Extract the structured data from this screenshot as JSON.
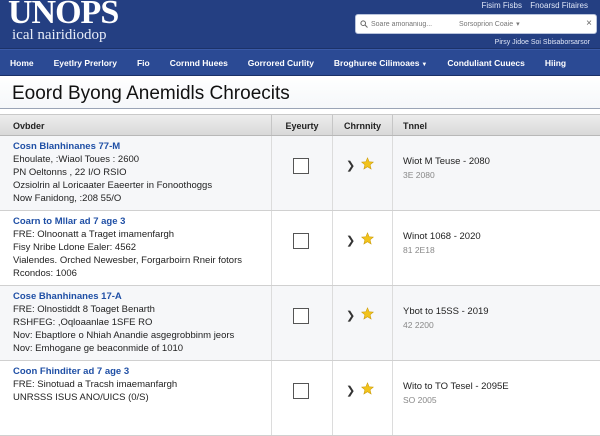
{
  "header": {
    "logo": "UNOPS",
    "logo_sub": "ical nairidiodop",
    "top_links": [
      "Fisim Fisbs",
      "Fnoarsd Fitaires"
    ],
    "search": {
      "placeholder": "Soare amonaniug...",
      "select_value": "Sorsoprion Coaie"
    },
    "sub_links": "Pirsy Jidoe Soi Sbisaborsarsor"
  },
  "nav": {
    "items": [
      "Home",
      "Eyetlry Prerlory",
      "Fio",
      "Cornnd Huees",
      "Gorrored Curlity",
      "Broghuree Cilimoaes",
      "Conduliant Cuuecs",
      "Hiing"
    ]
  },
  "page": {
    "title": "Eoord Byong Anemidls Chroecits"
  },
  "table": {
    "headers": [
      "Ovbder",
      "Eyeurty",
      "Chrnnity",
      "Tnnel"
    ],
    "rows": [
      {
        "title": "Cosn Blanhinanes 77-M",
        "lines": [
          "Ehoulate, :Wiaol Toues : 2600",
          "PN Oeltonns , 22 I/O RSIO",
          "Ozsiolrin al Loricaater Eaeerter in Fonoothoggs",
          "Now Fanidong, :208 55/O"
        ],
        "date": "Wiot M Teuse - 2080",
        "date_sub": "3E 2080"
      },
      {
        "title": "Coarn to Mllar ad 7 age 3",
        "lines": [
          "FRE: Olnoonatt a Traget imamenfargh",
          "Fisy Nribe Ldone Ealer: 4562",
          "Vialendes. Orched Newesber, Forgarboirn Rneir fotors",
          "Rcondos: 1006"
        ],
        "date": "Winot 1068 - 2020",
        "date_sub": "81 2E18"
      },
      {
        "title": "Cose Bhanhinanes 17-A",
        "lines": [
          "FRE: Olnostiddt 8 Toaget Benarth",
          "RSHFEG: ,Oqloaanlae 1SFE RO",
          "Nov: Ebaptlore o Nhiah Anandie asgegrobbinm jeors",
          "Nov: Emhogane ge beaconmide of 1010"
        ],
        "date": "Ybot to 15SS - 2019",
        "date_sub": "42 2200"
      },
      {
        "title": "Coon Fhinditer ad 7 age 3",
        "lines": [
          "FRE: Sinotuad a Tracsh imaemanfargh",
          "UNRSSS ISUS ANO/UICS (0/S)"
        ],
        "date": "Wito to TO Tesel - 2095E",
        "date_sub": "SO 2005"
      }
    ]
  },
  "colors": {
    "header_bg": "#243f82",
    "nav_bg": "#2b4a94",
    "link": "#1f4fa5",
    "star": "#f2c31b"
  }
}
